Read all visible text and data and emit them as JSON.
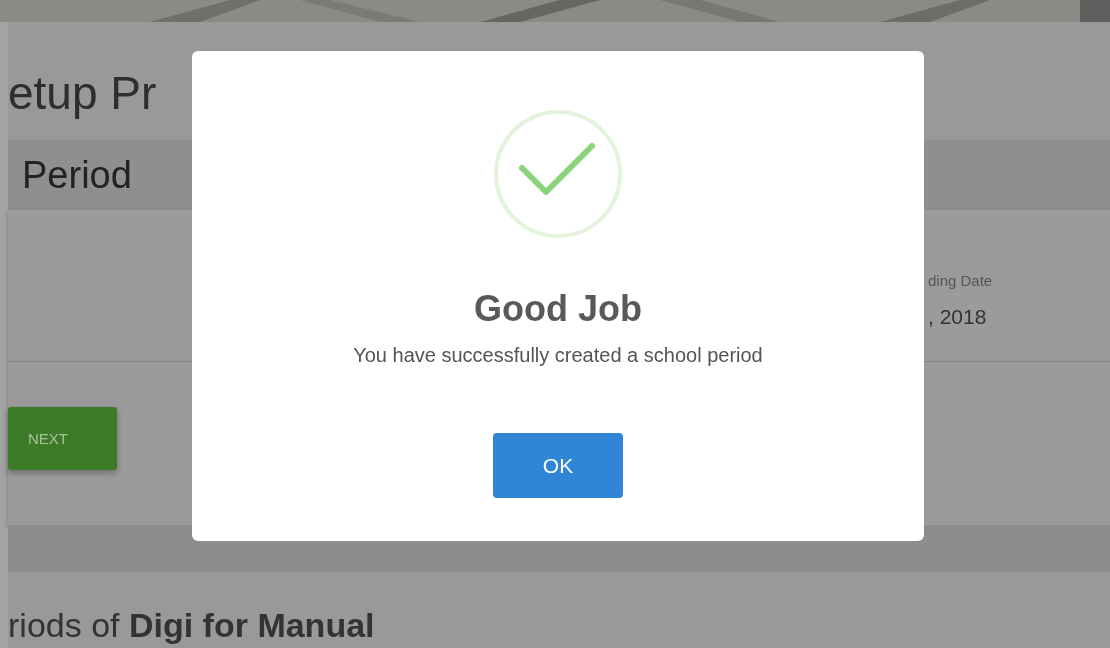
{
  "page": {
    "title": "etup Pr",
    "section": "Period",
    "field_label": "ding Date",
    "field_value": ", 2018",
    "next_button": "NEXT",
    "list_heading": "riods of **Digi for Manual**"
  },
  "dialog": {
    "kind": "success",
    "title": "Good Job",
    "message": "You have successfully created a school period",
    "confirm_button": "OK"
  }
}
